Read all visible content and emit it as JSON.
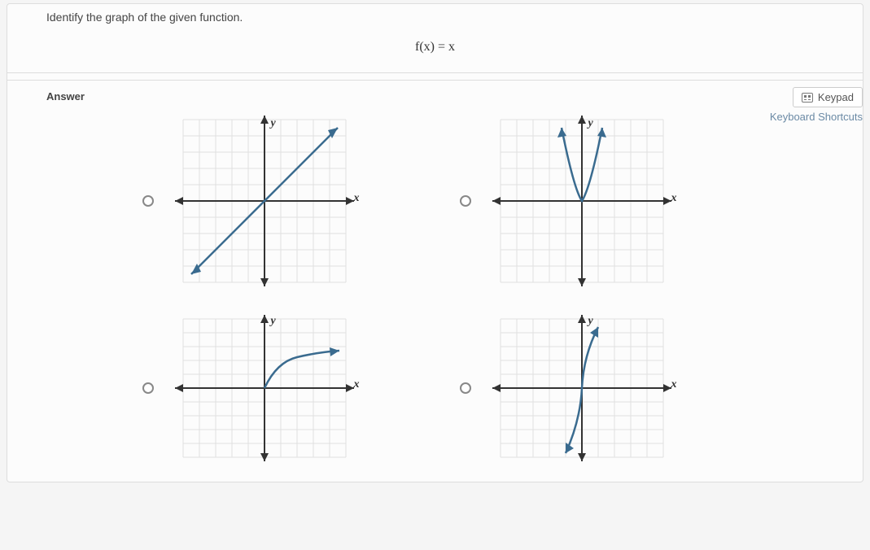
{
  "question": {
    "prompt": "Identify the graph of the given function."
  },
  "function": {
    "display": "f(x) = x"
  },
  "answer": {
    "label": "Answer"
  },
  "tools": {
    "keypad": "Keypad",
    "shortcuts": "Keyboard Shortcuts"
  },
  "axes": {
    "x": "x",
    "y": "y"
  },
  "choices": [
    {
      "id": "choice-1",
      "kind": "linear"
    },
    {
      "id": "choice-2",
      "kind": "absolute"
    },
    {
      "id": "choice-3",
      "kind": "sqrt"
    },
    {
      "id": "choice-4",
      "kind": "cubic"
    }
  ]
}
